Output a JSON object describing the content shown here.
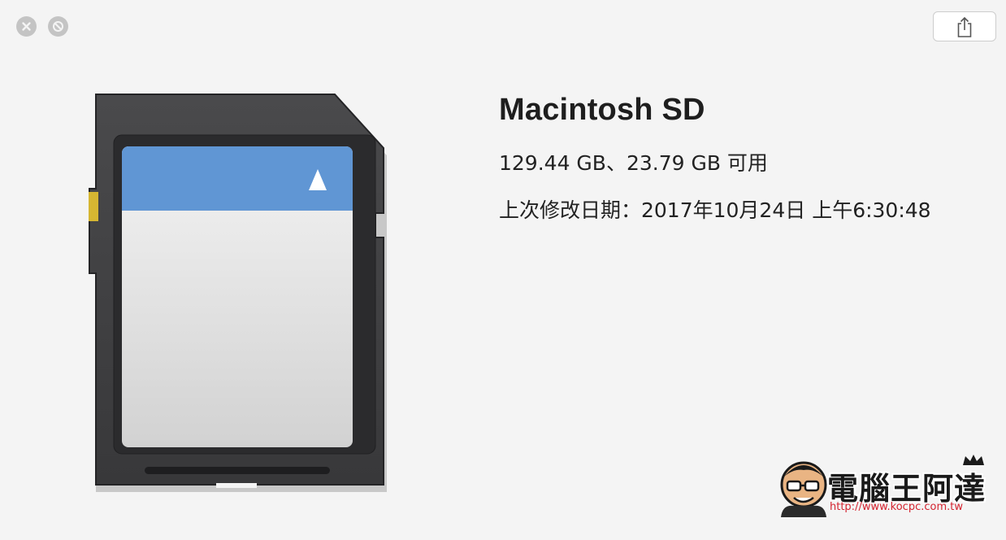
{
  "window": {
    "close_icon": "close-icon",
    "fullscreen_icon": "no-entry-icon",
    "share_icon": "share-icon"
  },
  "volume": {
    "name": "Macintosh SD",
    "capacity": "129.44 GB、23.79 GB 可用",
    "modified": "上次修改日期：2017年10月24日 上午6:30:48"
  },
  "watermark": {
    "title": "電腦王阿達",
    "url": "http://www.kocpc.com.tw"
  },
  "colors": {
    "background": "#f4f4f4",
    "card_body": "#3b3b3d",
    "label_band": "#6096d4",
    "contact": "#d6b632",
    "url_red": "#d4232f"
  }
}
